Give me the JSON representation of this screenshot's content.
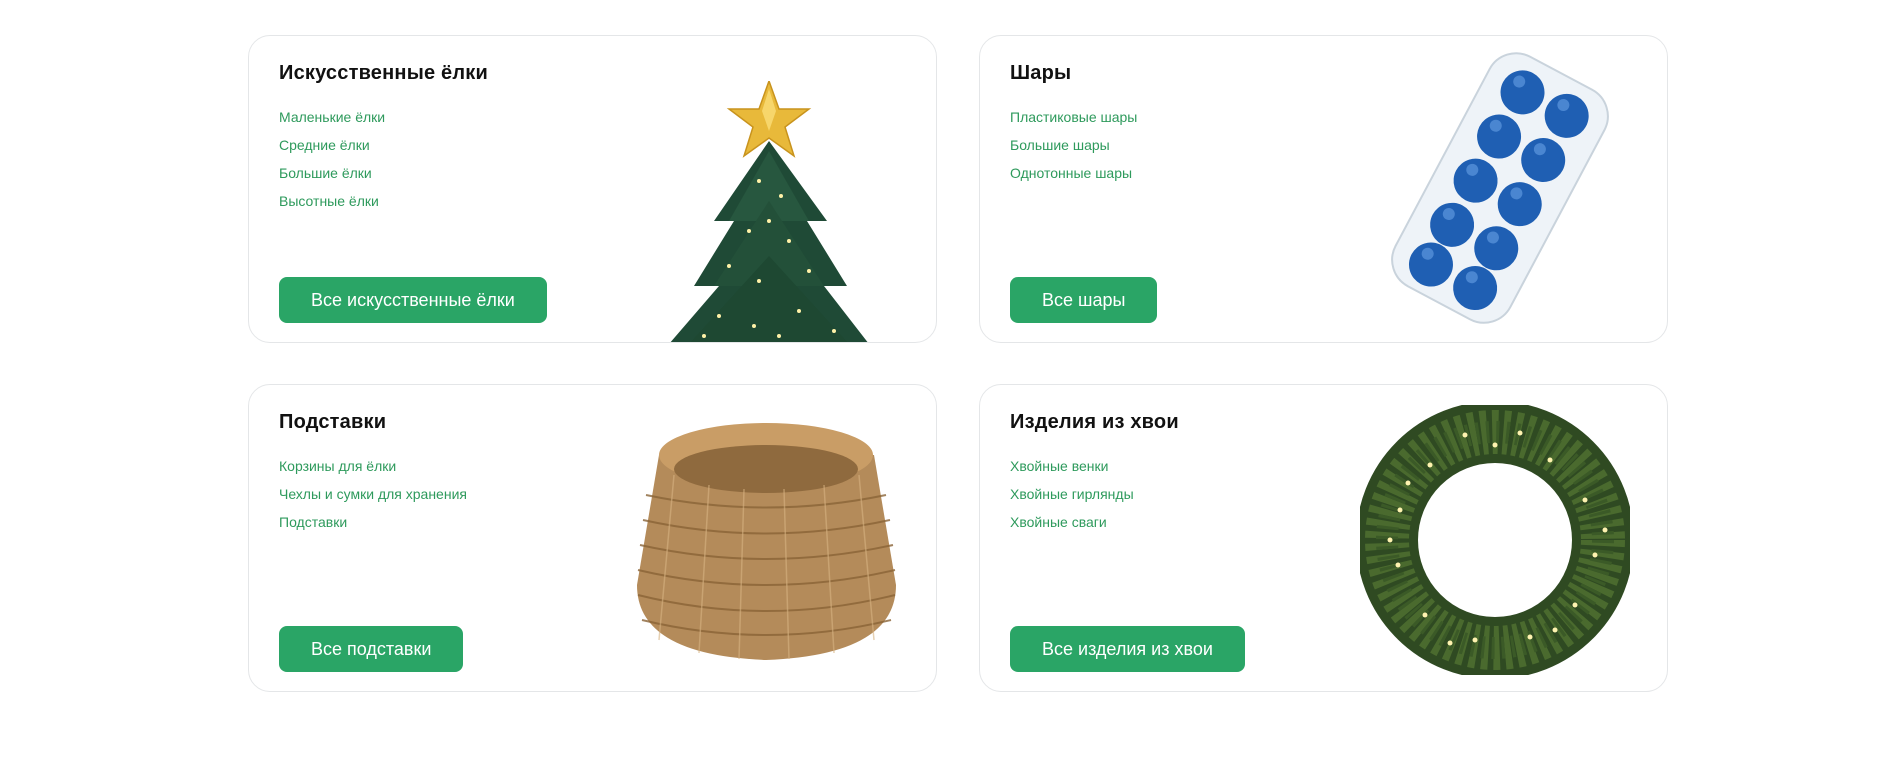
{
  "categories": [
    {
      "title": "Искусственные ёлки",
      "links": [
        "Маленькие ёлки",
        "Средние ёлки",
        "Большие ёлки",
        "Высотные ёлки"
      ],
      "button": "Все искусственные ёлки",
      "image": "christmas-tree-with-star"
    },
    {
      "title": "Шары",
      "links": [
        "Пластиковые шары",
        "Большие шары",
        "Однотонные шары"
      ],
      "button": "Все шары",
      "image": "box-of-blue-ornaments"
    },
    {
      "title": "Подставки",
      "links": [
        "Корзины для ёлки",
        "Чехлы и сумки для хранения",
        "Подставки"
      ],
      "button": "Все подставки",
      "image": "wicker-tree-basket"
    },
    {
      "title": "Изделия из хвои",
      "links": [
        "Хвойные венки",
        "Хвойные гирлянды",
        "Хвойные сваги"
      ],
      "button": "Все изделия из хвои",
      "image": "lit-pine-wreath"
    }
  ],
  "colors": {
    "accent": "#2aa566",
    "link": "#2e9a5c",
    "title": "#111111",
    "card_border": "#e4e6e8"
  }
}
